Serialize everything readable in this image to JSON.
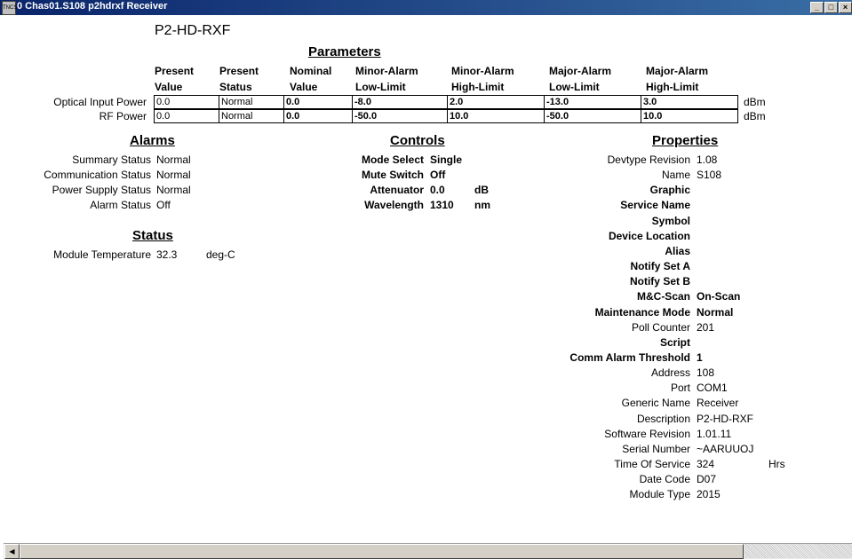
{
  "window": {
    "title": "0 Chas01.S108 p2hdrxf Receiver",
    "icon": "tncs-app-icon",
    "min": "_",
    "max": "□",
    "close": "×"
  },
  "device_title": "P2-HD-RXF",
  "parameters": {
    "heading": "Parameters",
    "columns": [
      {
        "l1": "Present",
        "l2": "Value"
      },
      {
        "l1": "Present",
        "l2": "Status"
      },
      {
        "l1": "Nominal",
        "l2": "Value"
      },
      {
        "l1": "Minor-Alarm",
        "l2": "Low-Limit"
      },
      {
        "l1": "Minor-Alarm",
        "l2": "High-Limit"
      },
      {
        "l1": "Major-Alarm",
        "l2": "Low-Limit"
      },
      {
        "l1": "Major-Alarm",
        "l2": "High-Limit"
      }
    ],
    "rows": [
      {
        "label": "Optical Input Power",
        "cells": [
          "0.0",
          "Normal",
          "0.0",
          "-8.0",
          "2.0",
          "-13.0",
          "3.0"
        ],
        "unit": "dBm"
      },
      {
        "label": "RF Power",
        "cells": [
          "0.0",
          "Normal",
          "0.0",
          "-50.0",
          "10.0",
          "-50.0",
          "10.0"
        ],
        "unit": "dBm"
      }
    ]
  },
  "alarms": {
    "heading": "Alarms",
    "items": [
      {
        "label": "Summary Status",
        "value": "Normal"
      },
      {
        "label": "Communication Status",
        "value": "Normal"
      },
      {
        "label": "Power Supply Status",
        "value": "Normal"
      },
      {
        "label": "Alarm Status",
        "value": "Off"
      }
    ]
  },
  "status": {
    "heading": "Status",
    "items": [
      {
        "label": "Module Temperature",
        "value": "32.3",
        "unit": "deg-C"
      }
    ]
  },
  "controls": {
    "heading": "Controls",
    "items": [
      {
        "label": "Mode Select",
        "value": "Single",
        "unit": ""
      },
      {
        "label": "Mute Switch",
        "value": "Off",
        "unit": ""
      },
      {
        "label": "Attenuator",
        "value": "0.0",
        "unit": "dB"
      },
      {
        "label": "Wavelength",
        "value": "1310",
        "unit": "nm"
      }
    ]
  },
  "properties": {
    "heading": "Properties",
    "items": [
      {
        "label": "Devtype Revision",
        "value": "1.08",
        "bold": false
      },
      {
        "label": "Name",
        "value": "S108",
        "bold": false
      },
      {
        "label": "Graphic",
        "value": "",
        "bold": true
      },
      {
        "label": "Service Name",
        "value": "",
        "bold": true
      },
      {
        "label": "Symbol",
        "value": "",
        "bold": true
      },
      {
        "label": "Device Location",
        "value": "",
        "bold": true
      },
      {
        "label": "Alias",
        "value": "",
        "bold": true
      },
      {
        "label": "Notify Set A",
        "value": "",
        "bold": true
      },
      {
        "label": "Notify Set B",
        "value": "",
        "bold": true
      },
      {
        "label": "M&C-Scan",
        "value": "On-Scan",
        "bold": true
      },
      {
        "label": "Maintenance Mode",
        "value": "Normal",
        "bold": true
      },
      {
        "label": "Poll Counter",
        "value": "201",
        "bold": false
      },
      {
        "label": "Script",
        "value": "",
        "bold": true
      },
      {
        "label": "Comm Alarm Threshold",
        "value": "1",
        "bold": true
      },
      {
        "label": "Address",
        "value": "108",
        "bold": false
      },
      {
        "label": "Port",
        "value": "COM1",
        "bold": false
      },
      {
        "label": "Generic Name",
        "value": "Receiver",
        "bold": false
      },
      {
        "label": "Description",
        "value": "P2-HD-RXF",
        "bold": false
      },
      {
        "label": "Software Revision",
        "value": "1.01.11",
        "bold": false
      },
      {
        "label": "Serial Number",
        "value": "~AARUUOJ",
        "bold": false
      },
      {
        "label": "Time Of Service",
        "value": "324",
        "bold": false,
        "unit": "Hrs"
      },
      {
        "label": "Date Code",
        "value": "D07",
        "bold": false
      },
      {
        "label": "Module Type",
        "value": "2015",
        "bold": false
      }
    ]
  },
  "scrollbar": {
    "left_arrow": "◀"
  }
}
